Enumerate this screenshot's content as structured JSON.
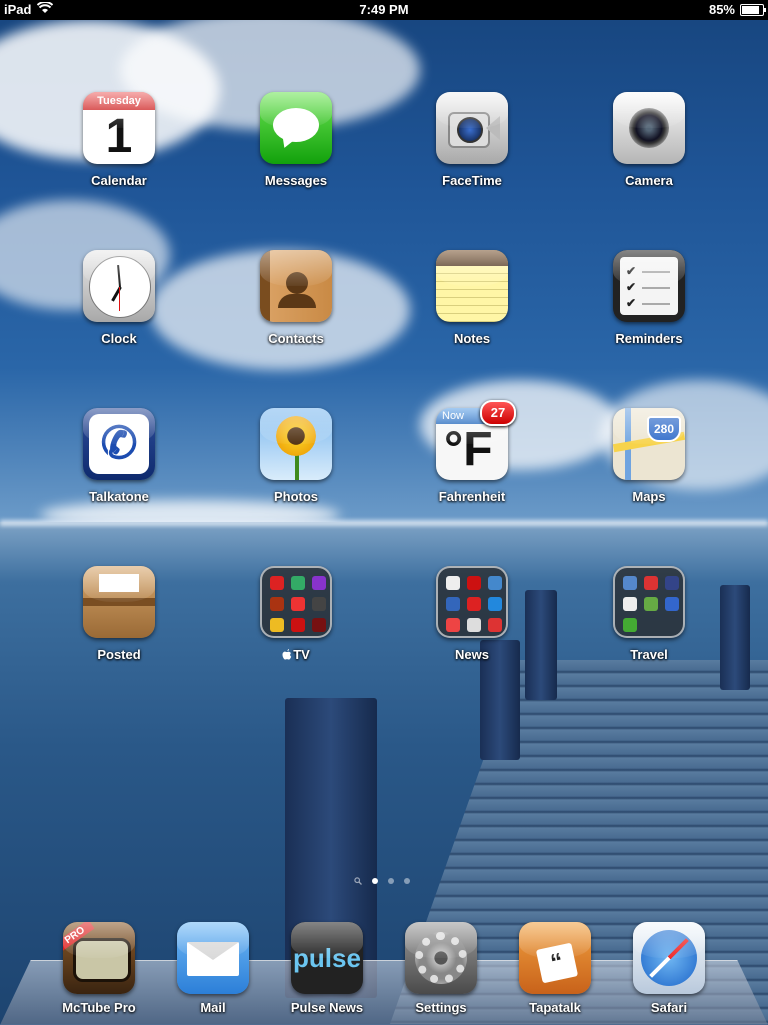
{
  "status_bar": {
    "device": "iPad",
    "time": "7:49 PM",
    "battery": "85%",
    "battery_level": 0.85
  },
  "apps": {
    "calendar": {
      "label": "Calendar",
      "weekday": "Tuesday",
      "day": "1"
    },
    "messages": {
      "label": "Messages"
    },
    "facetime": {
      "label": "FaceTime"
    },
    "camera": {
      "label": "Camera"
    },
    "clock": {
      "label": "Clock"
    },
    "contacts": {
      "label": "Contacts"
    },
    "notes": {
      "label": "Notes"
    },
    "reminders": {
      "label": "Reminders"
    },
    "talkatone": {
      "label": "Talkatone"
    },
    "photos": {
      "label": "Photos"
    },
    "fahrenheit": {
      "label": "Fahrenheit",
      "tag": "Now",
      "unit": "°F",
      "badge": "27"
    },
    "maps": {
      "label": "Maps",
      "route": "280"
    },
    "posted": {
      "label": "Posted"
    },
    "tv_folder": {
      "label": "TV"
    },
    "news_folder": {
      "label": "News"
    },
    "travel_folder": {
      "label": "Travel"
    }
  },
  "page_dots": {
    "count": 3,
    "active": 1
  },
  "dock": {
    "mctube": {
      "label": "McTube Pro",
      "tag": "PRO"
    },
    "mail": {
      "label": "Mail"
    },
    "pulse": {
      "label": "Pulse News",
      "wordmark": "pulse"
    },
    "settings": {
      "label": "Settings"
    },
    "tapatalk": {
      "label": "Tapatalk"
    },
    "safari": {
      "label": "Safari"
    }
  },
  "colors": {
    "badge": "#d00000",
    "label_text": "#ffffff",
    "status_bar_bg": "#000000"
  }
}
